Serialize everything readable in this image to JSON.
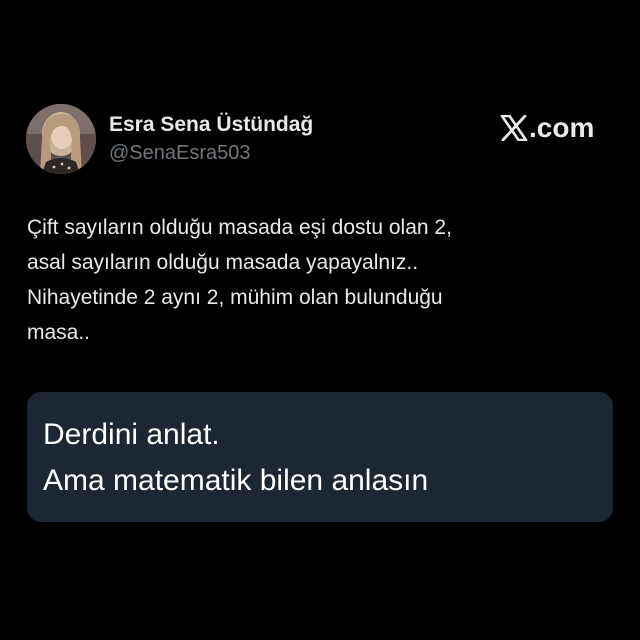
{
  "author": {
    "display_name": "Esra Sena Üstündağ",
    "handle": "@SenaEsra503",
    "avatar": "profile-photo"
  },
  "brand": {
    "logo_icon": "x-logo-icon",
    "label": ".com"
  },
  "post": {
    "lines": [
      "Çift sayıların olduğu masada eşi dostu olan 2,",
      "asal sayıların olduğu masada yapayalnız..",
      "Nihayetinde 2 aynı 2, mühim olan bulunduğu",
      "masa.."
    ]
  },
  "attached_image": {
    "lines": [
      "Derdini anlat.",
      "Ama matematik bilen anlasın"
    ]
  },
  "colors": {
    "background": "#000000",
    "text_primary": "#e7e9ea",
    "text_secondary": "#71767b",
    "card_background": "#1c2733"
  }
}
